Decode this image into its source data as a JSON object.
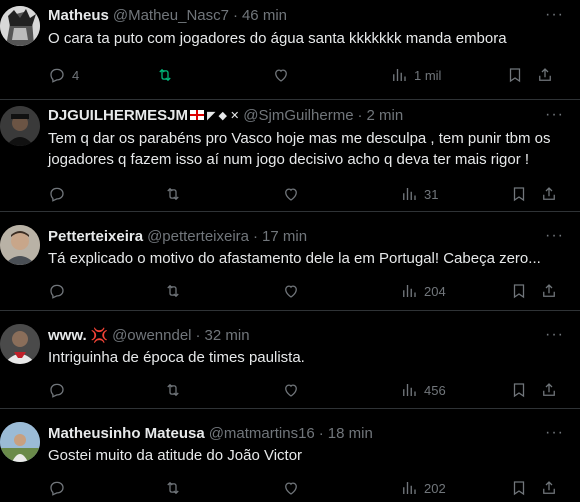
{
  "tweets": [
    {
      "name": "Matheus",
      "handle": "@Matheu_Nasc7",
      "time": "46 min",
      "text": "O cara ta puto com jogadores do água santa kkkkkkk manda embora",
      "replies": "4",
      "retweets": "",
      "likes": "",
      "views": "1 mil",
      "retweeted": true
    },
    {
      "name": "DJGUILHERMESJM",
      "handle": "@SjmGuilherme",
      "time": "2 min",
      "text": "Tem q dar os parabéns pro Vasco hoje mas me desculpa , tem punir tbm os jogadores q fazem isso aí num jogo decisivo acho q deva ter mais rigor !",
      "replies": "",
      "retweets": "",
      "likes": "",
      "views": "31",
      "retweeted": false
    },
    {
      "name": "Petterteixeira",
      "handle": "@petterteixeira",
      "time": "17 min",
      "text": "Tá  explicado o motivo do afastamento dele la em Portugal! Cabeça zero...",
      "replies": "",
      "retweets": "",
      "likes": "",
      "views": "204",
      "retweeted": false
    },
    {
      "name": "www.",
      "handle": "@owenndel",
      "time": "32 min",
      "text": "Intriguinha de época de times paulista.",
      "replies": "",
      "retweets": "",
      "likes": "",
      "views": "456",
      "retweeted": false
    },
    {
      "name": "Matheusinho Mateusa",
      "handle": "@matmartins16",
      "time": "18 min",
      "text": "Gostei muito da atitude do João Victor",
      "replies": "",
      "retweets": "",
      "likes": "",
      "views": "202",
      "retweeted": false
    }
  ],
  "separator": "·",
  "more_glyph": "···",
  "colors": {
    "background": "#000000",
    "text": "#e7e9ea",
    "muted": "#71767b",
    "retweet_active": "#00ba7c",
    "border": "#2f3336"
  }
}
